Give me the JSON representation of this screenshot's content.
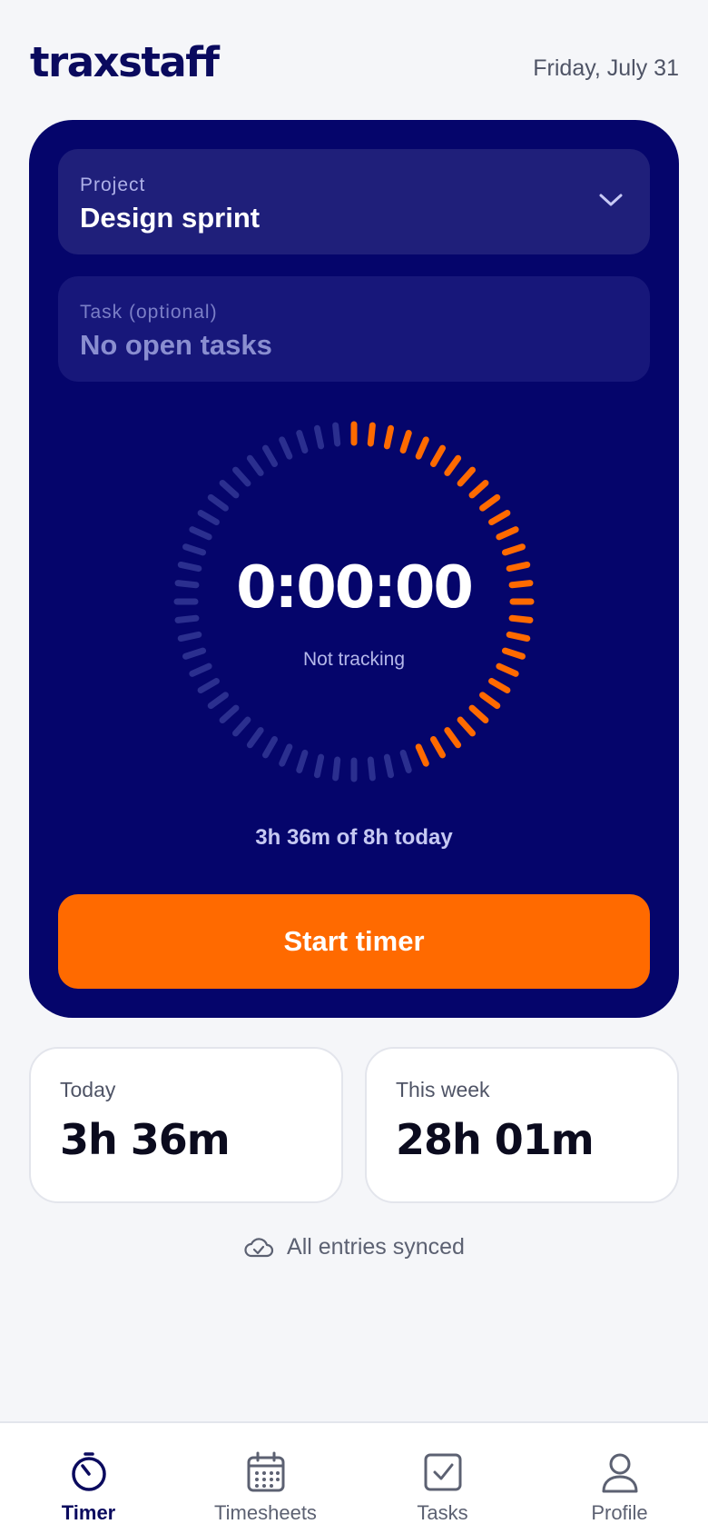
{
  "header": {
    "logo": "traxstaff",
    "date": "Friday, July 31"
  },
  "timer_card": {
    "project": {
      "label": "Project",
      "value": "Design sprint",
      "icon": "chevron-down-icon"
    },
    "task": {
      "label": "Task (optional)",
      "value": "No open tasks"
    },
    "time": "0:00:00",
    "status": "Not tracking",
    "progress_text": "3h 36m of 8h today",
    "progress_fraction": 0.45,
    "start_label": "Start timer"
  },
  "stats": {
    "today": {
      "label": "Today",
      "value": "3h 36m"
    },
    "week": {
      "label": "This week",
      "value": "28h 01m"
    }
  },
  "sync": {
    "icon": "cloud-check-icon",
    "text": "All entries synced"
  },
  "nav": {
    "items": [
      {
        "label": "Timer",
        "icon": "stopwatch-icon",
        "active": true
      },
      {
        "label": "Timesheets",
        "icon": "calendar-icon",
        "active": false
      },
      {
        "label": "Tasks",
        "icon": "checkbox-icon",
        "active": false
      },
      {
        "label": "Profile",
        "icon": "person-icon",
        "active": false
      }
    ]
  },
  "colors": {
    "brand_navy": "#05056b",
    "accent_orange": "#ff6a00",
    "dial_inactive": "#2b2f8f"
  }
}
